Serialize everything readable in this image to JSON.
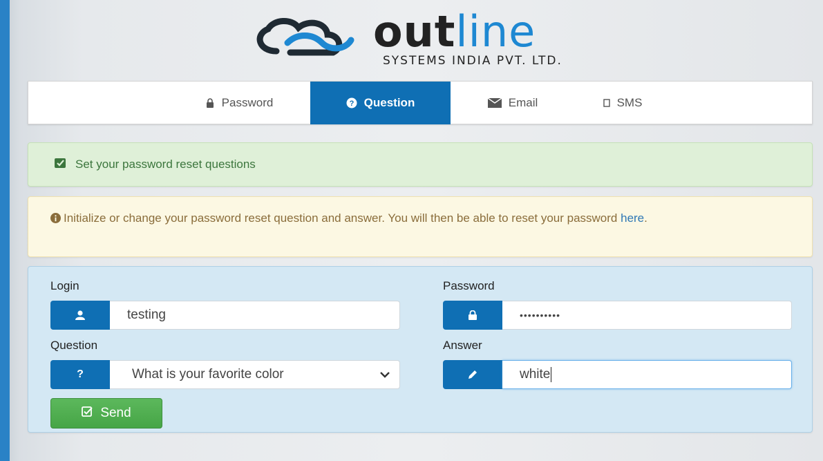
{
  "logo": {
    "word_bold": "out",
    "word_light": "line",
    "subtitle": "SYSTEMS INDIA PVT. LTD.",
    "brand_blue": "#1e88d2"
  },
  "tabs": [
    {
      "label": "Password",
      "icon": "lock-icon",
      "active": false
    },
    {
      "label": "Question",
      "icon": "question-circle-icon",
      "active": true
    },
    {
      "label": "Email",
      "icon": "envelope-icon",
      "active": false
    },
    {
      "label": "SMS",
      "icon": "mobile-icon",
      "active": false
    }
  ],
  "alerts": {
    "success": {
      "icon": "check-square-icon",
      "text": "Set your password reset questions"
    },
    "warning": {
      "icon": "info-circle-icon",
      "text": "Initialize or change your password reset question and answer. You will then be able to reset your password",
      "link_text": "here",
      "suffix": "."
    }
  },
  "form": {
    "login": {
      "label": "Login",
      "value": "testing",
      "icon": "user-icon"
    },
    "password": {
      "label": "Password",
      "value": "••••••••••",
      "icon": "lock-icon"
    },
    "question": {
      "label": "Question",
      "value": "What is your favorite color",
      "icon": "question-icon"
    },
    "answer": {
      "label": "Answer",
      "value": "white",
      "icon": "pencil-icon"
    },
    "send_label": "Send"
  },
  "colors": {
    "accent": "#0f6fb4",
    "success_bg": "#dff0d8",
    "warning_bg": "#fcf8e3",
    "panel_bg": "#d4e8f4",
    "button_green": "#5cb85c"
  }
}
